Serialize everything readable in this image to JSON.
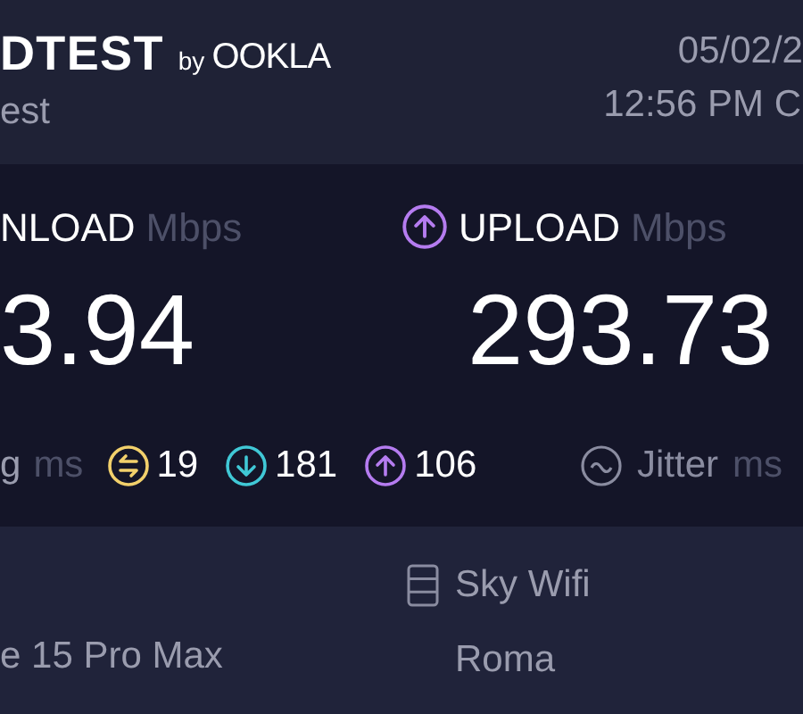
{
  "header": {
    "logo_text": "DTEST",
    "logo_by": "by",
    "logo_brand": "OOKLA",
    "subtitle": "est",
    "date": "05/02/2",
    "time": "12:56 PM C"
  },
  "results": [
    {
      "kind": "download",
      "label": "NLOAD",
      "unit": "Mbps",
      "value": "3.94"
    },
    {
      "kind": "upload",
      "label": "UPLOAD",
      "unit": "Mbps",
      "value": "293.73"
    }
  ],
  "ping": {
    "label": "g",
    "unit": "ms",
    "metrics": [
      {
        "kind": "idle",
        "value": "19"
      },
      {
        "kind": "download",
        "value": "181"
      },
      {
        "kind": "upload",
        "value": "106"
      }
    ]
  },
  "jitter": {
    "label": "Jitter",
    "unit": "ms"
  },
  "device": {
    "name": "e 15 Pro Max"
  },
  "server": {
    "provider": "Sky Wifi",
    "location": "Roma"
  }
}
